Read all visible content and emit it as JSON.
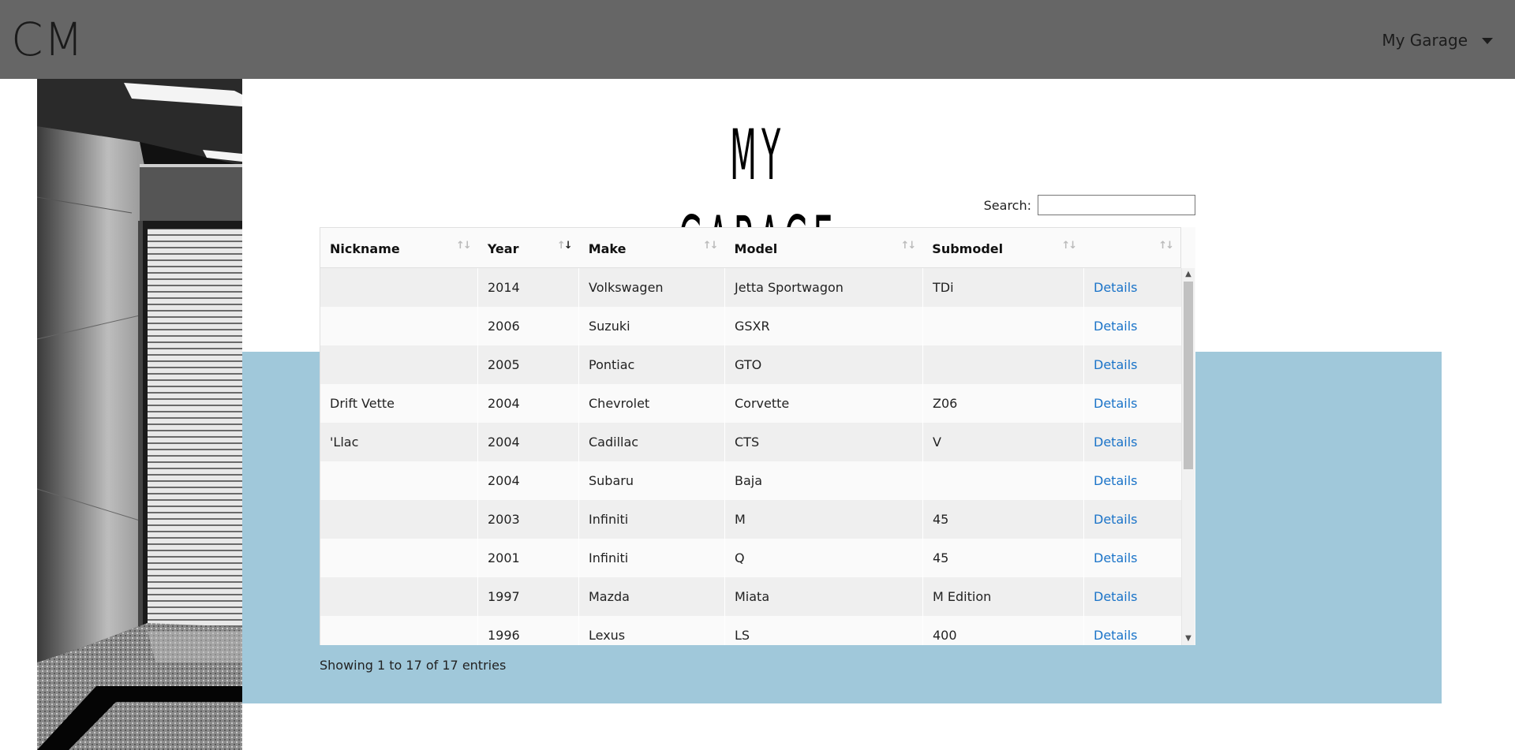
{
  "header": {
    "logo": "CM",
    "nav_label": "My Garage"
  },
  "page": {
    "title": "MY GARAGE"
  },
  "search": {
    "label": "Search:",
    "value": ""
  },
  "table": {
    "columns": [
      "Nickname",
      "Year",
      "Make",
      "Model",
      "Submodel",
      ""
    ],
    "sorted_column": "Year",
    "sort_direction": "descending",
    "rows": [
      {
        "nickname": "",
        "year": "2014",
        "make": "Volkswagen",
        "model": "Jetta Sportwagon",
        "submodel": "TDi",
        "action": "Details"
      },
      {
        "nickname": "",
        "year": "2006",
        "make": "Suzuki",
        "model": "GSXR",
        "submodel": "",
        "action": "Details"
      },
      {
        "nickname": "",
        "year": "2005",
        "make": "Pontiac",
        "model": "GTO",
        "submodel": "",
        "action": "Details"
      },
      {
        "nickname": "Drift Vette",
        "year": "2004",
        "make": "Chevrolet",
        "model": "Corvette",
        "submodel": "Z06",
        "action": "Details"
      },
      {
        "nickname": "'Llac",
        "year": "2004",
        "make": "Cadillac",
        "model": "CTS",
        "submodel": "V",
        "action": "Details"
      },
      {
        "nickname": "",
        "year": "2004",
        "make": "Subaru",
        "model": "Baja",
        "submodel": "",
        "action": "Details"
      },
      {
        "nickname": "",
        "year": "2003",
        "make": "Infiniti",
        "model": "M",
        "submodel": "45",
        "action": "Details"
      },
      {
        "nickname": "",
        "year": "2001",
        "make": "Infiniti",
        "model": "Q",
        "submodel": "45",
        "action": "Details"
      },
      {
        "nickname": "",
        "year": "1997",
        "make": "Mazda",
        "model": "Miata",
        "submodel": "M Edition",
        "action": "Details"
      },
      {
        "nickname": "",
        "year": "1996",
        "make": "Lexus",
        "model": "LS",
        "submodel": "400",
        "action": "Details"
      }
    ],
    "info": "Showing 1 to 17 of 17 entries"
  },
  "colors": {
    "header_bg": "#666666",
    "band_bg": "#a0c8da",
    "link": "#1a73c8"
  },
  "icons": {
    "nav_caret": "chevron-down-icon",
    "sort": "sort-icon"
  }
}
